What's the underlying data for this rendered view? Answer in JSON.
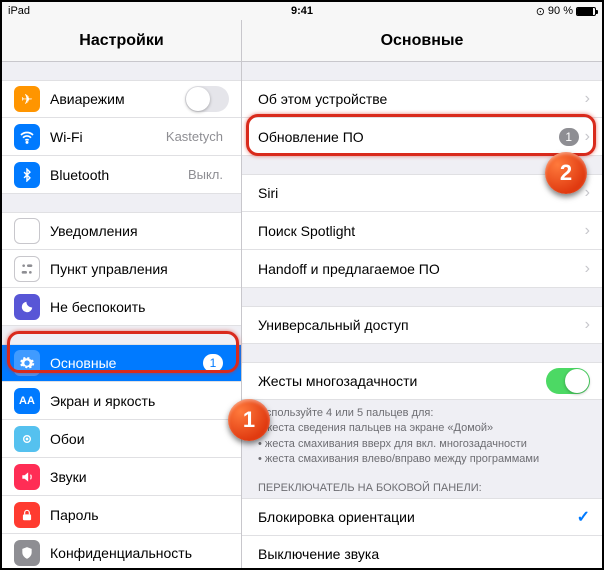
{
  "status": {
    "device": "iPad",
    "time": "9:41",
    "battery_pct": "90 %",
    "charging_glyph": "⊙"
  },
  "headers": {
    "left": "Настройки",
    "right": "Основные"
  },
  "sidebar": {
    "groups": [
      {
        "items": [
          {
            "icon": "airplane",
            "label": "Авиарежим",
            "accessory": "toggle-off"
          },
          {
            "icon": "wifi",
            "label": "Wi-Fi",
            "value": "Kastetych"
          },
          {
            "icon": "bluetooth",
            "label": "Bluetooth",
            "value": "Выкл."
          }
        ]
      },
      {
        "items": [
          {
            "icon": "notif",
            "label": "Уведомления"
          },
          {
            "icon": "control",
            "label": "Пункт управления"
          },
          {
            "icon": "dnd",
            "label": "Не беспокоить"
          }
        ]
      },
      {
        "items": [
          {
            "icon": "general",
            "label": "Основные",
            "badge": "1",
            "selected": true
          },
          {
            "icon": "display",
            "label": "Экран и яркость"
          },
          {
            "icon": "wallpaper",
            "label": "Обои"
          },
          {
            "icon": "sounds",
            "label": "Звуки"
          },
          {
            "icon": "passcode",
            "label": "Пароль"
          },
          {
            "icon": "privacy",
            "label": "Конфиденциальность"
          }
        ]
      }
    ]
  },
  "detail": {
    "groups": [
      {
        "items": [
          {
            "label": "Об этом устройстве",
            "chevron": true
          },
          {
            "label": "Обновление ПО",
            "badge": "1",
            "chevron": true,
            "highlight": true
          }
        ]
      },
      {
        "items": [
          {
            "label": "Siri",
            "chevron": true
          },
          {
            "label": "Поиск Spotlight",
            "chevron": true
          },
          {
            "label": "Handoff и предлагаемое ПО",
            "chevron": true
          }
        ]
      },
      {
        "items": [
          {
            "label": "Универсальный доступ",
            "chevron": true
          }
        ]
      },
      {
        "items": [
          {
            "label": "Жесты многозадачности",
            "accessory": "toggle-on"
          }
        ],
        "hint_lines": [
          "Используйте 4 или 5 пальцев для:",
          "• жеста сведения пальцев на экране «Домой»",
          "• жеста смахивания вверх для вкл. многозадачности",
          "• жеста смахивания влево/вправо между программами"
        ]
      },
      {
        "header": "ПЕРЕКЛЮЧАТЕЛЬ НА БОКОВОЙ ПАНЕЛИ:",
        "items": [
          {
            "label": "Блокировка ориентации",
            "check": true
          },
          {
            "label": "Выключение звука"
          }
        ]
      }
    ]
  },
  "callouts": {
    "one": "1",
    "two": "2"
  }
}
